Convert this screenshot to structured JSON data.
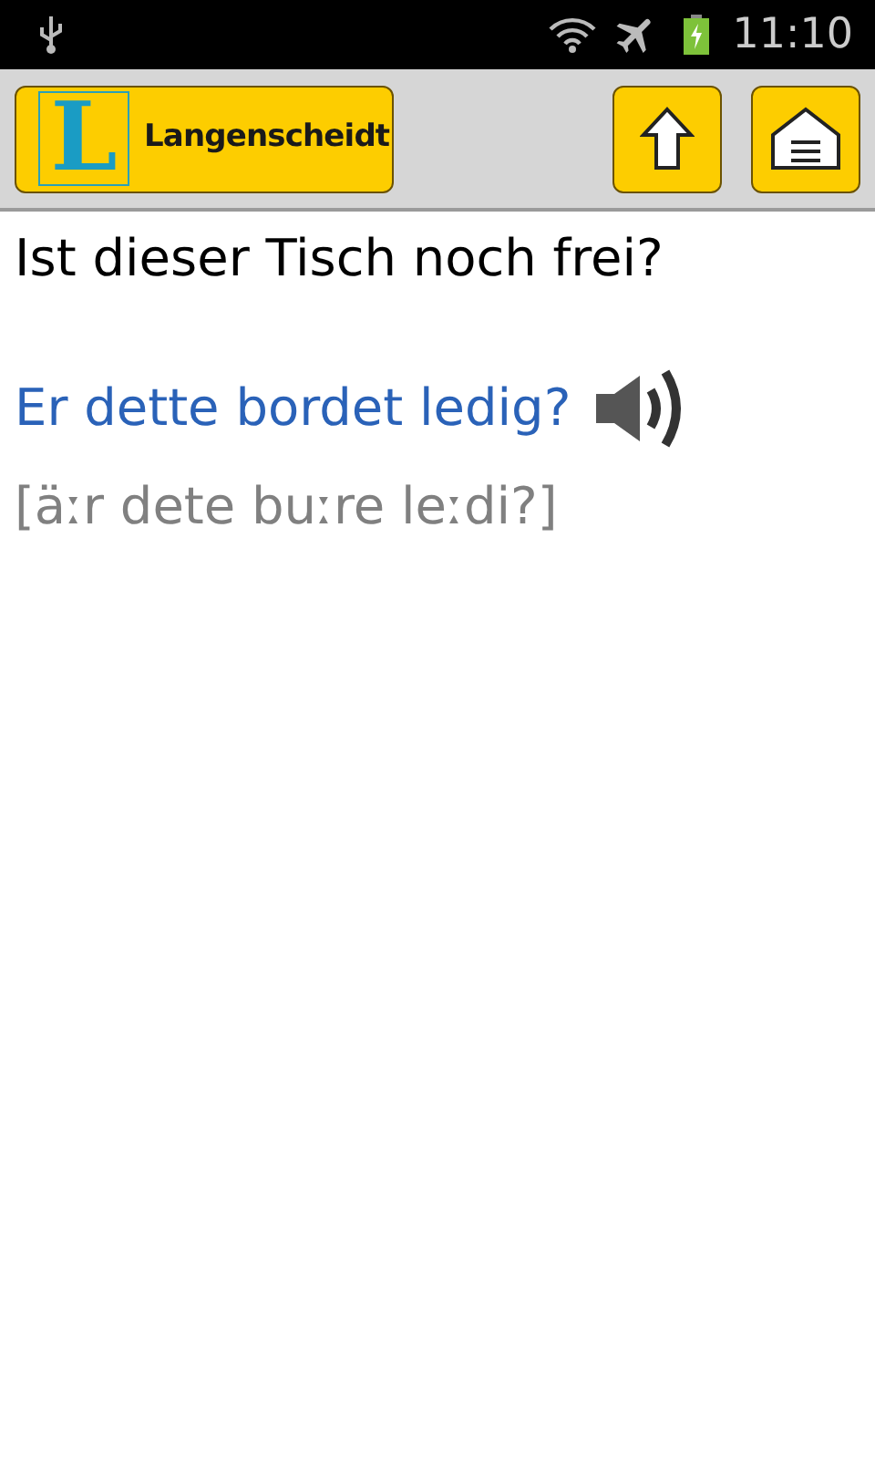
{
  "status_bar": {
    "time": "11:10"
  },
  "toolbar": {
    "logo_letter": "L",
    "logo_text": "Langenscheidt"
  },
  "phrase": {
    "source": "Ist dieser Tisch noch frei?",
    "translation": "Er dette bordet ledig?",
    "pronunciation": "[äːr dete buːre leːdi?]"
  }
}
